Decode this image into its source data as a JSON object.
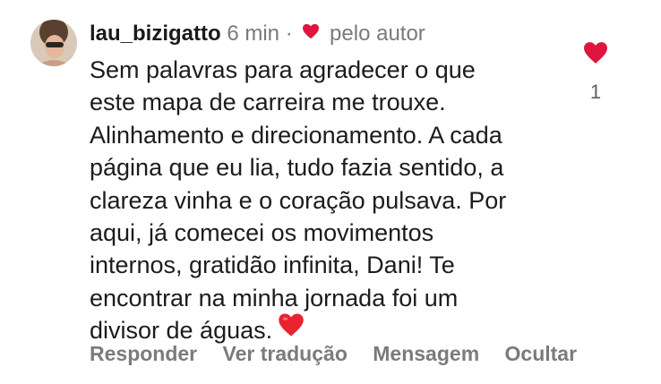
{
  "comment": {
    "username": "lau_bizigatto",
    "time": "6 min",
    "separator": "·",
    "liked_by_author": "pelo autor",
    "text_lines": [
      "Sem palavras para agradecer o que",
      "este mapa de carreira me trouxe.",
      "Alinhamento e direcionamento. A cada",
      "página que eu lia, tudo fazia sentido, a",
      "clareza vinha e o coração pulsava. Por",
      "aqui, já comecei os movimentos",
      "internos, gratidão infinita, Dani! Te",
      "encontrar na minha jornada foi um",
      "divisor de águas."
    ],
    "emoji": "red-heart-emoji"
  },
  "like": {
    "icon": "heart-icon",
    "count": "1",
    "color": "#e0143c"
  },
  "actions": {
    "reply": "Responder",
    "translate": "Ver tradução",
    "message": "Mensagem",
    "hide": "Ocultar"
  }
}
